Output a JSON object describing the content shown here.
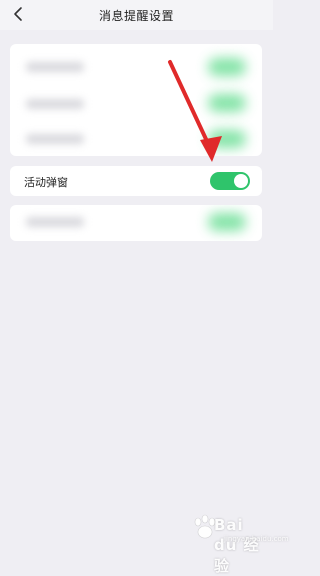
{
  "header": {
    "title": "消息提醒设置",
    "back_icon": "chevron-left-icon"
  },
  "activity_popup": {
    "label": "活动弹窗",
    "enabled": true,
    "toggle_color": "#2fc46b"
  },
  "watermark": {
    "text": "Bai du 经验",
    "sub": "jingyan.baidu.com"
  }
}
